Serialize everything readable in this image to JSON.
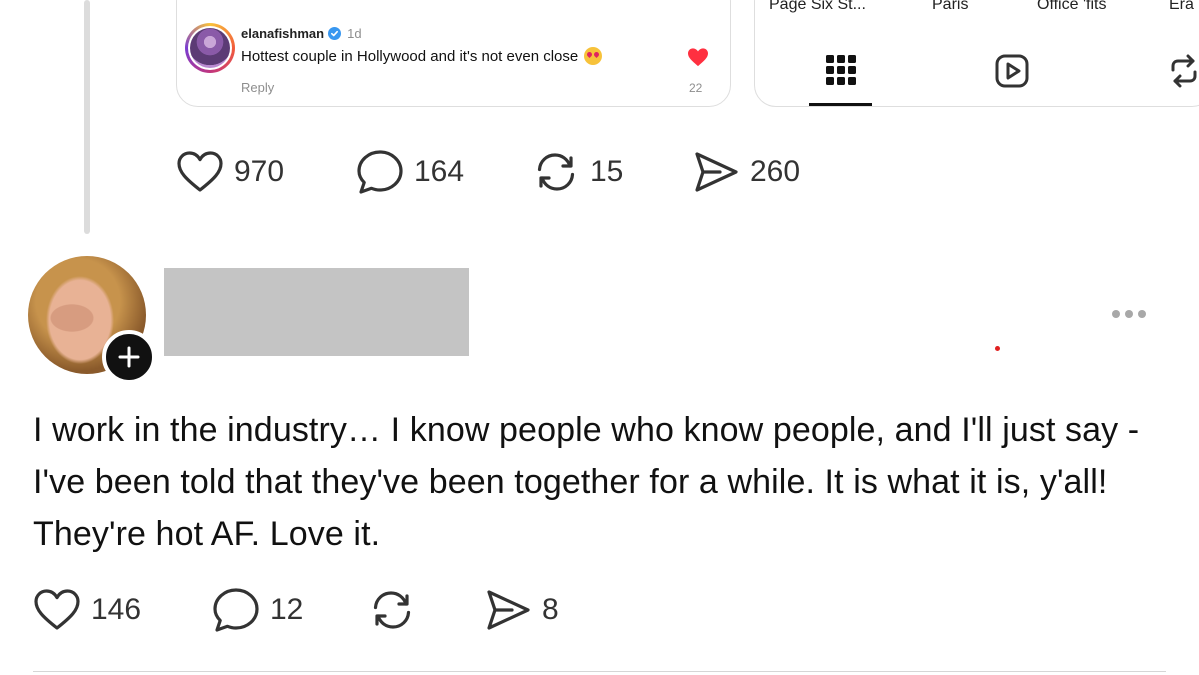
{
  "embedded_comment": {
    "username": "elanafishman",
    "time": "1d",
    "text": "Hottest couple in Hollywood and it's not even close",
    "reply_label": "Reply",
    "like_count": "22"
  },
  "profile_card": {
    "highlights": [
      "Page Six St...",
      "Paris",
      "Office 'fits",
      "Era"
    ],
    "tabs": [
      "grid-icon",
      "reels-icon",
      "reposts-icon"
    ]
  },
  "parent_post_actions": {
    "likes": "970",
    "comments": "164",
    "reposts": "15",
    "shares": "260"
  },
  "reply_post": {
    "text": "I work in the industry… I know people who know people, and I'll just say - I've been told that they've been together for a while. It is what it is, y'all! They're hot AF. Love it.",
    "actions": {
      "likes": "146",
      "comments": "12",
      "shares": "8"
    }
  },
  "colors": {
    "like_red": "#ff3040",
    "verified_blue": "#3897f0",
    "redaction_gray": "#c4c4c4"
  }
}
